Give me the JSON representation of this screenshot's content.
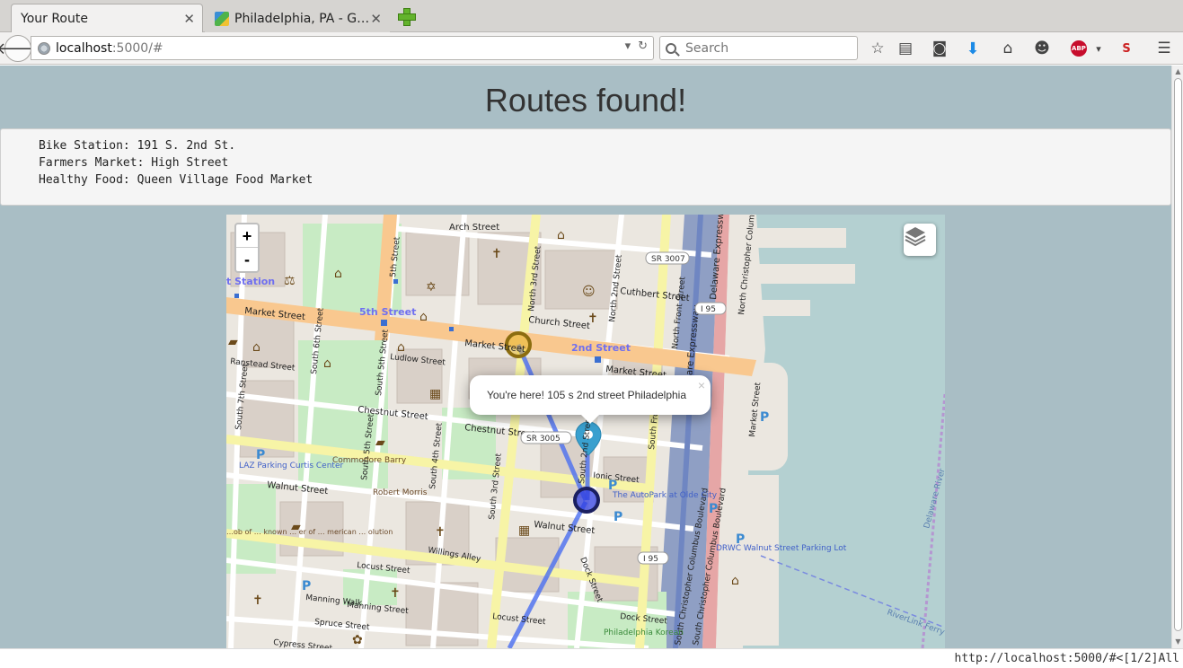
{
  "browser": {
    "tabs": [
      {
        "title": "Your Route",
        "active": true
      },
      {
        "title": "Philadelphia, PA - G…",
        "active": false
      }
    ],
    "url": {
      "host": "localhost",
      "rest": ":5000/#"
    },
    "search_placeholder": "Search"
  },
  "page": {
    "title": "Routes found!",
    "results": {
      "bike_station": "Bike Station: 191 S. 2nd St.",
      "farmers_market": "Farmers Market: High Street",
      "healthy_food": "Healthy Food: Queen Village Food Market"
    }
  },
  "map": {
    "zoom_in": "+",
    "zoom_out": "-",
    "popup_text": "You're here! 105 s 2nd street Philadelphia",
    "popup_close": "×",
    "labels": {
      "station": "t Station",
      "fifth_street_station": "5th Street",
      "second_street_station": "2nd Street",
      "arch_street": "Arch Street",
      "market_street_w": "Market Street",
      "market_street_c": "Market Street",
      "market_street_e": "Market Street",
      "church_street": "Church Street",
      "cuthbert_street": "Cuthbert Street",
      "ranstead_street": "Ranstead Street",
      "ludlow_street": "Ludlow Street",
      "chestnut_street_w": "Chestnut Street",
      "chestnut_street_e": "Chestnut Street",
      "walnut_street_w": "Walnut Street",
      "walnut_street_e": "Walnut Street",
      "ionic_street": "Ionic Street",
      "locust_street_w": "Locust Street",
      "locust_street_e": "Locust Street",
      "spruce_street": "Spruce Street",
      "cypress_street": "Cypress Street",
      "manning_walk": "Manning Walk",
      "manning_street": "Manning Street",
      "willings_alley": "Willings Alley",
      "dock_street": "Dock Street",
      "dock_street_s": "Dock Street",
      "north_3rd": "North 3rd Street",
      "north_2nd": "North 2nd Street",
      "north_front": "North Front Street",
      "south_7th": "South 7th Street",
      "south_6th": "South 6th Street",
      "south_5th": "South 5th Street",
      "south_5th_b": "South 5th Street",
      "south_4th": "South 4th Street",
      "south_3rd": "South 3rd Street",
      "south_2nd": "South 2nd Street",
      "south_front": "South Front Street",
      "fifth_street_n": "5th Street",
      "delaware_expressway": "Delaware Expressway",
      "delaware_expressway_s": "Delaware Expressway",
      "market_street_pier": "Market Street",
      "north_columbus": "North Christopher Columbus",
      "south_columbus": "South Christopher Columbus Boulevard",
      "south_columbus_b": "South Christopher Columbus Boulevard",
      "delaware_river": "Delaware River",
      "riverlink_ferry": "RiverLink Ferry",
      "sr3007": "SR 3007",
      "sr3005": "SR 3005",
      "i95_n": "I 95",
      "i95_s": "I 95",
      "laz_parking": "LAZ Parking Curtis Center",
      "commodore_barry": "Commodore Barry",
      "robert_morris": "Robert Morris",
      "autopark": "The AutoPark at Olde City",
      "drwc_parking": "DRWC Walnut Street Parking Lot",
      "philadelphia_korean": "Philadelphia Korean",
      "museum_partial": "…ob of … known … er of … merican … olution",
      "parking_p": "P"
    }
  },
  "status_bar": {
    "url": "http://localhost:5000/#",
    "vim": "<[1/2]All"
  },
  "colors": {
    "page_bg": "#a9bec5",
    "route": "#4a6ef0",
    "marker_yellow": "#e8b821",
    "marker_blue": "#2f3ee0",
    "pin": "#39a0cf"
  },
  "icons": [
    "back-icon",
    "globe-icon",
    "dropdown-icon",
    "reload-icon",
    "search-icon",
    "star-icon",
    "reading-list-icon",
    "pocket-icon",
    "download-icon",
    "home-icon",
    "chat-icon",
    "adblock-icon",
    "extension-icon",
    "menu-icon",
    "layers-icon"
  ]
}
